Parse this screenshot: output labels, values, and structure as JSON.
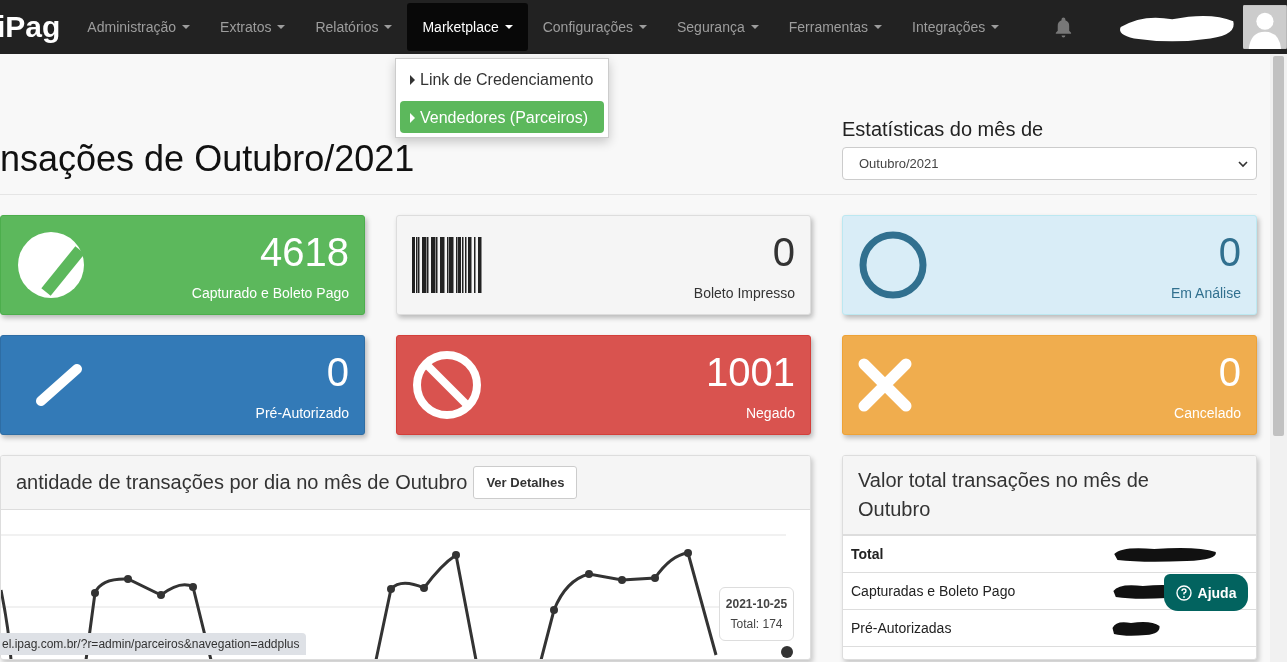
{
  "navbar": {
    "brand": "iPag",
    "items": [
      {
        "label": "Administração",
        "selected": false
      },
      {
        "label": "Extratos",
        "selected": false
      },
      {
        "label": "Relatórios",
        "selected": false
      },
      {
        "label": "Marketplace",
        "selected": true
      },
      {
        "label": "Configurações",
        "selected": false
      },
      {
        "label": "Segurança",
        "selected": false
      },
      {
        "label": "Ferramentas",
        "selected": false
      },
      {
        "label": "Integrações",
        "selected": false
      }
    ]
  },
  "dropdown": {
    "items": [
      {
        "label": "Link de Credenciamento",
        "selected": false
      },
      {
        "label": "Vendedores (Parceiros)",
        "selected": true
      }
    ]
  },
  "page_title": "nsações de Outubro/2021",
  "stats_month": {
    "label": "Estatísticas do mês de",
    "value": "Outubro/2021"
  },
  "cards": [
    {
      "kind": "success",
      "value": "4618",
      "label": "Capturado e Boleto Pago"
    },
    {
      "kind": "default",
      "value": "0",
      "label": "Boleto Impresso"
    },
    {
      "kind": "info",
      "value": "0",
      "label": "Em Análise"
    },
    {
      "kind": "primary",
      "value": "0",
      "label": "Pré-Autorizado"
    },
    {
      "kind": "danger",
      "value": "1001",
      "label": "Negado"
    },
    {
      "kind": "warning",
      "value": "0",
      "label": "Cancelado"
    }
  ],
  "chart_panel": {
    "title": "antidade de transações por dia no mês de Outubro",
    "button": "Ver Detalhes",
    "tooltip": {
      "date": "2021-10-25",
      "total": "Total: 174"
    }
  },
  "value_panel": {
    "title": "Valor total transações no mês de Outubro",
    "rows": [
      {
        "kind": "total",
        "label": "Total"
      },
      {
        "kind": "item",
        "label": "Capturadas e Boleto Pago"
      },
      {
        "kind": "item",
        "label": "Pré-Autorizadas"
      }
    ]
  },
  "help_button": "Ajuda",
  "status_url": "el.ipag.com.br/?r=admin/parceiros&navegation=addplus"
}
